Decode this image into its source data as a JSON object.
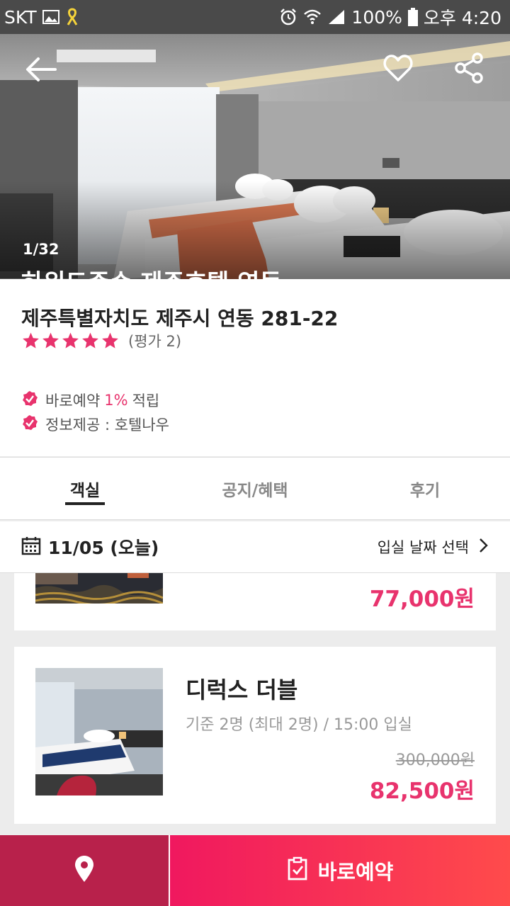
{
  "status_bar": {
    "carrier": "SKT",
    "battery": "100%",
    "time": "오후 4:20"
  },
  "hero": {
    "photo_counter": "1/32",
    "title_peek": "하워드존슨 제주호텔 연동"
  },
  "info": {
    "address": "제주특별자치도 제주시 연동 281-22",
    "star_count": 5,
    "rating_text": "(평가 2)",
    "perk_1_prefix": "바로예약",
    "perk_1_accent": "1%",
    "perk_1_suffix": "적립",
    "perk_2": "정보제공 : 호텔나우"
  },
  "tabs": [
    {
      "label": "객실",
      "active": true
    },
    {
      "label": "공지/혜택",
      "active": false
    },
    {
      "label": "후기",
      "active": false
    }
  ],
  "datebar": {
    "date": "11/05 (오늘)",
    "pick_label": "입실 날짜 선택"
  },
  "rooms": [
    {
      "price": "77,000원"
    },
    {
      "name": "디럭스 더블",
      "capacity": "기준 2명 (최대 2명) / 15:00 입실",
      "original_price": "300,000원",
      "price": "82,500원"
    }
  ],
  "bottom_bar": {
    "book_label": "바로예약"
  },
  "colors": {
    "accent": "#e8336d",
    "map_button": "#b8214b",
    "book_start": "#f0185f",
    "book_end": "#ff4b4b"
  }
}
